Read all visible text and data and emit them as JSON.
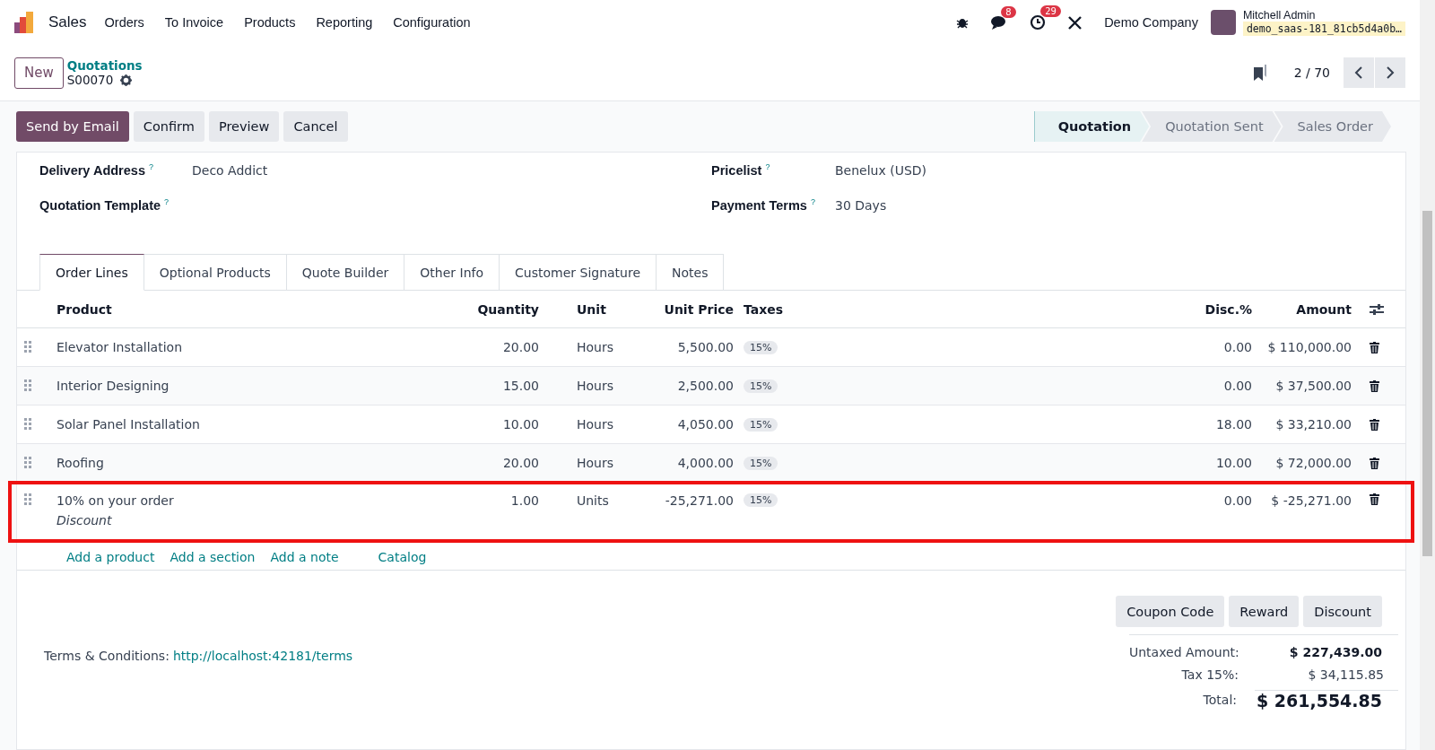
{
  "navbar": {
    "app": "Sales",
    "menu": [
      "Orders",
      "To Invoice",
      "Products",
      "Reporting",
      "Configuration"
    ],
    "messages_badge": "8",
    "activities_badge": "29",
    "company": "Demo Company",
    "user": "Mitchell Admin",
    "database": "demo_saas-181_81cb5d4a0b…"
  },
  "control_panel": {
    "new_button": "New",
    "breadcrumb": "Quotations",
    "record": "S00070",
    "pager": "2 / 70"
  },
  "actions": [
    {
      "label": "Send by Email",
      "primary": true
    },
    {
      "label": "Confirm",
      "primary": false
    },
    {
      "label": "Preview",
      "primary": false
    },
    {
      "label": "Cancel",
      "primary": false
    }
  ],
  "status_bar": [
    {
      "label": "Quotation",
      "selected": true
    },
    {
      "label": "Quotation Sent",
      "selected": false
    },
    {
      "label": "Sales Order",
      "selected": false
    }
  ],
  "fields_left": [
    {
      "label": "Delivery Address",
      "help": "?",
      "value": "Deco Addict"
    },
    {
      "label": "Quotation Template",
      "help": "?"
    }
  ],
  "fields_right": [
    {
      "label": "Pricelist",
      "help": "?",
      "value": "Benelux (USD)"
    },
    {
      "label": "Payment Terms",
      "help": "?",
      "value": "30 Days"
    }
  ],
  "tabs": [
    {
      "label": "Order Lines",
      "selected": true
    },
    {
      "label": "Optional Products",
      "selected": false
    },
    {
      "label": "Quote Builder",
      "selected": false
    },
    {
      "label": "Other Info",
      "selected": false
    },
    {
      "label": "Customer Signature",
      "selected": false
    },
    {
      "label": "Notes",
      "selected": false
    }
  ],
  "table": {
    "columns": [
      "Product",
      "Quantity",
      "Unit",
      "Unit Price",
      "Taxes",
      "Disc.%",
      "Amount"
    ],
    "rows": [
      {
        "product": "Elevator Installation",
        "quantity": "20.00",
        "unit": "Hours",
        "unit_price": "5,500.00",
        "tax": "15%",
        "disc": "0.00",
        "amount": "$ 110,000.00",
        "highlighted": false
      },
      {
        "product": "Interior Designing",
        "quantity": "15.00",
        "unit": "Hours",
        "unit_price": "2,500.00",
        "tax": "15%",
        "disc": "0.00",
        "amount": "$ 37,500.00",
        "highlighted": false
      },
      {
        "product": "Solar Panel Installation",
        "quantity": "10.00",
        "unit": "Hours",
        "unit_price": "4,050.00",
        "tax": "15%",
        "disc": "18.00",
        "amount": "$ 33,210.00",
        "highlighted": false
      },
      {
        "product": "Roofing",
        "quantity": "20.00",
        "unit": "Hours",
        "unit_price": "4,000.00",
        "tax": "15%",
        "disc": "10.00",
        "amount": "$ 72,000.00",
        "highlighted": false
      },
      {
        "product": "10% on your order",
        "description": "Discount",
        "quantity": "1.00",
        "unit": "Units",
        "unit_price": "-25,271.00",
        "tax": "15%",
        "disc": "0.00",
        "amount": "$ -25,271.00",
        "highlighted": true
      }
    ],
    "add_links": [
      "Add a product",
      "Add a section",
      "Add a note",
      "Catalog"
    ]
  },
  "terms": {
    "label": "Terms & Conditions:",
    "link": "http://localhost:42181/terms"
  },
  "reward_buttons": [
    "Coupon Code",
    "Reward",
    "Discount"
  ],
  "totals": [
    {
      "label": "Untaxed Amount:",
      "value": "$ 227,439.00",
      "kind": "subtotal"
    },
    {
      "label": "Tax 15%:",
      "value": "$ 34,115.85",
      "kind": "tax"
    },
    {
      "label": "Total:",
      "value": "$ 261,554.85",
      "kind": "total"
    }
  ]
}
